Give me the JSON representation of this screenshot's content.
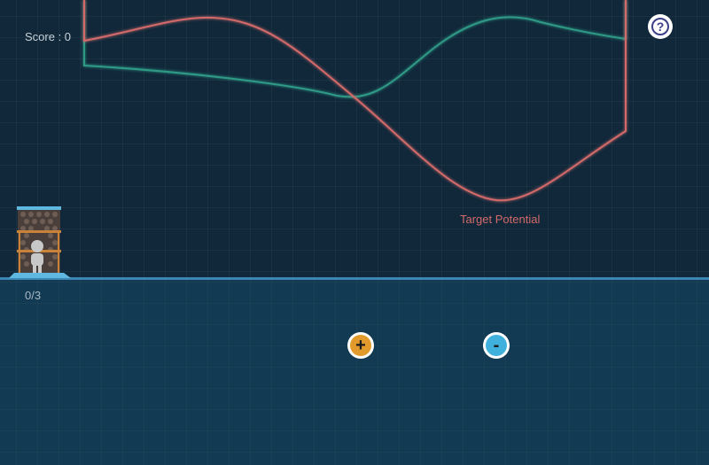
{
  "hud": {
    "score_text": "Score : 0",
    "help_label": "?",
    "progress_text": "0/3"
  },
  "plot": {
    "target_label": "Target Potential",
    "colors": {
      "target_curve": "#d36a6a",
      "current_curve": "#2f9a86",
      "background": "#10283a",
      "floor": "#3d86b3"
    }
  },
  "controls": {
    "plus_label": "+",
    "minus_label": "-",
    "plus_color": "#e39a2c",
    "minus_color": "#3fb1dc"
  },
  "icons": {
    "help": "question-mark-icon",
    "emitter": "particle-emitter-tower-icon",
    "plus": "plus-icon",
    "minus": "minus-icon"
  }
}
